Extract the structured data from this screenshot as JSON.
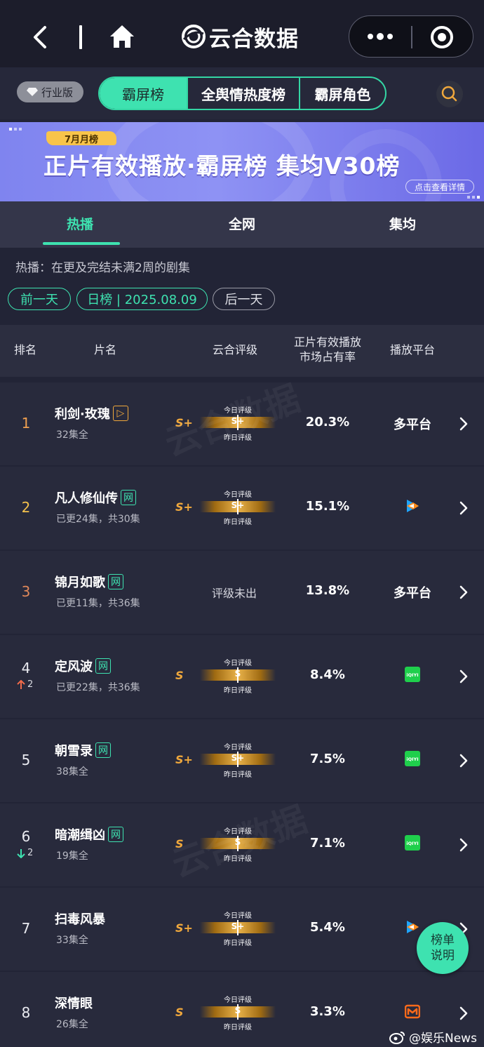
{
  "brand": {
    "name": "云合数据"
  },
  "segment": {
    "vip_label": "行业版",
    "options": [
      "霸屏榜",
      "全舆情热度榜",
      "霸屏角色"
    ]
  },
  "banner": {
    "tag": "7月月榜",
    "headline": "正片有效播放·霸屏榜 集均V30榜",
    "detail": "点击查看详情"
  },
  "tabs": [
    "热播",
    "全网",
    "集均"
  ],
  "description": "热播：在更及完结未满2周的剧集",
  "date_nav": {
    "prev": "前一天",
    "current": "日榜 | 2025.08.09",
    "next": "后一天"
  },
  "table_header": {
    "rank": "排名",
    "title": "片名",
    "rating": "云合评级",
    "share_l1": "正片有效播放",
    "share_l2": "市场占有率",
    "platform": "播放平台"
  },
  "meter_labels": {
    "today": "今日评级",
    "yesterday": "昨日评级"
  },
  "rows": [
    {
      "rank": "1",
      "rank_color": "#f0a050",
      "title": "利剑·玫瑰",
      "badge": "▷",
      "badge_type": "orange",
      "sub": "32集全",
      "grade": "S+",
      "meter": "S+",
      "share": "20.3%",
      "platform": "多平台",
      "platform_icon": ""
    },
    {
      "rank": "2",
      "rank_color": "#f3c04c",
      "title": "凡人修仙传",
      "badge": "网",
      "badge_type": "green",
      "sub": "已更24集，共30集",
      "grade": "S+",
      "meter": "S+",
      "share": "15.1%",
      "platform": "",
      "platform_icon": "tencent-video-icon"
    },
    {
      "rank": "3",
      "rank_color": "#e0885a",
      "title": "锦月如歌",
      "badge": "网",
      "badge_type": "green",
      "sub": "已更11集，共36集",
      "grade": "",
      "meter": "",
      "no_grade": "评级未出",
      "share": "13.8%",
      "platform": "多平台",
      "platform_icon": ""
    },
    {
      "rank": "4",
      "rank_color": "#e9eaf0",
      "move": "2",
      "move_dir": "up",
      "title": "定风波",
      "badge": "网",
      "badge_type": "green",
      "sub": "已更22集，共36集",
      "grade": "S",
      "meter": "S",
      "share": "8.4%",
      "platform": "",
      "platform_icon": "iqiyi-icon"
    },
    {
      "rank": "5",
      "rank_color": "#e9eaf0",
      "title": "朝雪录",
      "badge": "网",
      "badge_type": "green",
      "sub": "38集全",
      "grade": "S+",
      "meter": "S+",
      "share": "7.5%",
      "platform": "",
      "platform_icon": "iqiyi-icon"
    },
    {
      "rank": "6",
      "rank_color": "#e9eaf0",
      "move": "2",
      "move_dir": "down",
      "title": "暗潮缉凶",
      "badge": "网",
      "badge_type": "green",
      "sub": "19集全",
      "grade": "S",
      "meter": "S",
      "share": "7.1%",
      "platform": "",
      "platform_icon": "iqiyi-icon"
    },
    {
      "rank": "7",
      "rank_color": "#e9eaf0",
      "title": "扫毒风暴",
      "badge": "",
      "sub": "33集全",
      "grade": "S+",
      "meter": "S+",
      "share": "5.4%",
      "platform": "",
      "platform_icon": "tencent-video-icon"
    },
    {
      "rank": "8",
      "rank_color": "#e9eaf0",
      "title": "深情眼",
      "badge": "",
      "sub": "26集全",
      "grade": "S",
      "meter": "S",
      "share": "3.3%",
      "platform": "",
      "platform_icon": "mango-tv-icon"
    }
  ],
  "iqiyi_label": "iQIYI",
  "float_button": {
    "line1": "榜单",
    "line2": "说明"
  },
  "watermark": {
    "text": "@娱乐News"
  },
  "bg_watermark": {
    "text": "云合数据"
  },
  "colors": {
    "accent": "#3ee2b0",
    "gold": "#f0a83c",
    "bg": "#222436"
  }
}
